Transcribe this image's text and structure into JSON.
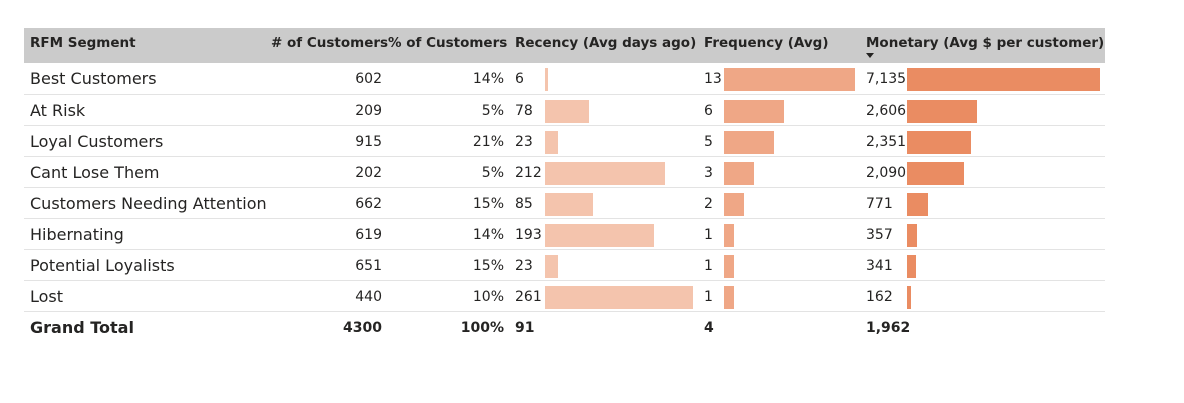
{
  "table": {
    "headers": {
      "segment": "RFM Segment",
      "customers": "# of Customers",
      "pct": "% of Customers",
      "recency": "Recency (Avg days ago)",
      "frequency": "Frequency (Avg)",
      "monetary": "Monetary (Avg $ per customer)"
    },
    "sort": {
      "column": "monetary",
      "direction": "descending"
    },
    "colors": {
      "recency_bar": "#f4c4ad",
      "frequency_bar": "#efa786",
      "monetary_bar": "#ea8c62",
      "header_bg": "#cbcbcb"
    },
    "rows": [
      {
        "segment": "Best Customers",
        "customers": "602",
        "pct": "14%",
        "recency": "6",
        "frequency": "13",
        "monetary": "7,135"
      },
      {
        "segment": "At Risk",
        "customers": "209",
        "pct": "5%",
        "recency": "78",
        "frequency": "6",
        "monetary": "2,606"
      },
      {
        "segment": "Loyal Customers",
        "customers": "915",
        "pct": "21%",
        "recency": "23",
        "frequency": "5",
        "monetary": "2,351"
      },
      {
        "segment": "Cant Lose Them",
        "customers": "202",
        "pct": "5%",
        "recency": "212",
        "frequency": "3",
        "monetary": "2,090"
      },
      {
        "segment": "Customers Needing Attention",
        "customers": "662",
        "pct": "15%",
        "recency": "85",
        "frequency": "2",
        "monetary": "771"
      },
      {
        "segment": "Hibernating",
        "customers": "619",
        "pct": "14%",
        "recency": "193",
        "frequency": "1",
        "monetary": "357"
      },
      {
        "segment": "Potential Loyalists",
        "customers": "651",
        "pct": "15%",
        "recency": "23",
        "frequency": "1",
        "monetary": "341"
      },
      {
        "segment": "Lost",
        "customers": "440",
        "pct": "10%",
        "recency": "261",
        "frequency": "1",
        "monetary": "162"
      }
    ],
    "total": {
      "segment": "Grand Total",
      "customers": "4300",
      "pct": "100%",
      "recency": "91",
      "frequency": "4",
      "monetary": "1,962"
    }
  },
  "chart_data": {
    "type": "table",
    "categories": [
      "Best Customers",
      "At Risk",
      "Loyal Customers",
      "Cant Lose Them",
      "Customers Needing Attention",
      "Hibernating",
      "Potential Loyalists",
      "Lost"
    ],
    "series": [
      {
        "name": "# of Customers",
        "values": [
          602,
          209,
          915,
          202,
          662,
          619,
          651,
          440
        ]
      },
      {
        "name": "% of Customers",
        "values": [
          14,
          5,
          21,
          5,
          15,
          14,
          15,
          10
        ]
      },
      {
        "name": "Recency (Avg days ago)",
        "values": [
          6,
          78,
          23,
          212,
          85,
          193,
          23,
          261
        ]
      },
      {
        "name": "Frequency (Avg)",
        "values": [
          13,
          6,
          5,
          3,
          2,
          1,
          1,
          1
        ]
      },
      {
        "name": "Monetary (Avg $ per customer)",
        "values": [
          7135,
          2606,
          2351,
          2090,
          771,
          357,
          341,
          162
        ]
      }
    ],
    "grand_total": {
      "customers": 4300,
      "pct": 100,
      "recency": 91,
      "frequency": 4,
      "monetary": 1962
    }
  }
}
